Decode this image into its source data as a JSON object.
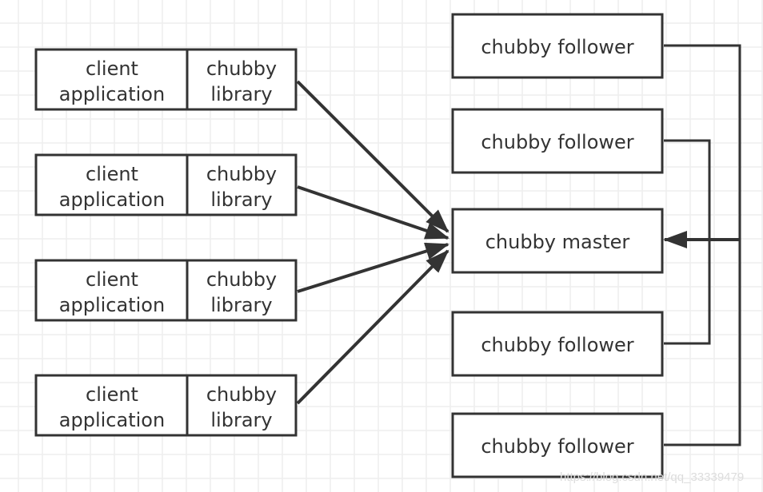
{
  "clients": [
    {
      "app_line1": "client",
      "app_line2": "application",
      "lib_line1": "chubby",
      "lib_line2": "library"
    },
    {
      "app_line1": "client",
      "app_line2": "application",
      "lib_line1": "chubby",
      "lib_line2": "library"
    },
    {
      "app_line1": "client",
      "app_line2": "application",
      "lib_line1": "chubby",
      "lib_line2": "library"
    },
    {
      "app_line1": "client",
      "app_line2": "application",
      "lib_line1": "chubby",
      "lib_line2": "library"
    }
  ],
  "servers": [
    {
      "label": "chubby  follower",
      "role": "follower"
    },
    {
      "label": "chubby  follower",
      "role": "follower"
    },
    {
      "label": "chubby  master",
      "role": "master"
    },
    {
      "label": "chubby  follower",
      "role": "follower"
    },
    {
      "label": "chubby  follower",
      "role": "follower"
    }
  ],
  "watermark": "https://blog.csdn.net/qq_33339479",
  "colors": {
    "stroke": "#333333",
    "grid": "#eeeeee"
  }
}
